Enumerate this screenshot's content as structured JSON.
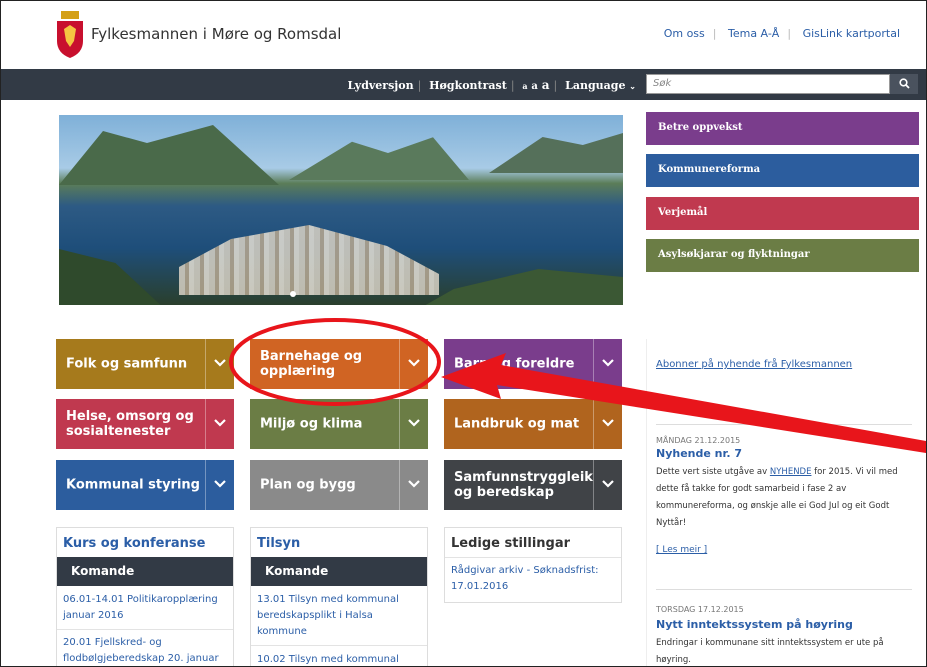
{
  "header": {
    "site_title": "Fylkesmannen i Møre og Romsdal",
    "top_links": [
      "Om oss",
      "Tema A-Å",
      "GisLink kartportal"
    ]
  },
  "toolbar": {
    "audio": "Lydversjon",
    "contrast": "Høgkontrast",
    "font_small": "a",
    "font_medium": "a",
    "font_large": "a",
    "language": "Language",
    "search_placeholder": "Søk",
    "search_icon": "search-icon"
  },
  "quick_links": [
    {
      "label": "Betre oppvekst",
      "color": "#7a3d8c"
    },
    {
      "label": "Kommunereforma",
      "color": "#2c5d9e"
    },
    {
      "label": "Verjemål",
      "color": "#c0394f"
    },
    {
      "label": "Asylsøkjarar og flyktningar",
      "color": "#6b7d45"
    }
  ],
  "tiles": [
    {
      "label": "Folk og samfunn",
      "color": "#a67a1c"
    },
    {
      "label": "Barnehage og opplæring",
      "color": "#d06423"
    },
    {
      "label": "Barn og foreldre",
      "color": "#7a3d8c"
    },
    {
      "label": "Helse, omsorg og sosialtenester",
      "color": "#c0394f"
    },
    {
      "label": "Miljø og klima",
      "color": "#6b7d45"
    },
    {
      "label": "Landbruk og mat",
      "color": "#b0641e"
    },
    {
      "label": "Kommunal styring",
      "color": "#2c5d9e"
    },
    {
      "label": "Plan og bygg",
      "color": "#8a8a8a"
    },
    {
      "label": "Samfunnstryggleik og beredskap",
      "color": "#404347"
    }
  ],
  "boxes": {
    "kurs": {
      "title": "Kurs og konferanse",
      "header": "Komande",
      "items": [
        "06.01-14.01 Politikaropplæring januar 2016",
        "20.01 Fjellskred- og flodbølgjeberedskap 20. januar"
      ]
    },
    "tilsyn": {
      "title": "Tilsyn",
      "header": "Komande",
      "items": [
        "13.01 Tilsyn med kommunal beredskapsplikt i Halsa kommune",
        "10.02 Tilsyn med kommunal"
      ]
    },
    "stillingar": {
      "title": "Ledige stillingar",
      "items": [
        "Rådgivar arkiv - Søknadsfrist: 17.01.2016"
      ]
    }
  },
  "news": {
    "subscribe": "Abonner på nyhende frå Fylkesmannen",
    "items": [
      {
        "date": "MÅNDAG 21.12.2015",
        "title": "Nyhende nr. 7",
        "text_before": "Dette vert siste utgåve av ",
        "text_link": "NYHENDE",
        "text_after": " for 2015. Vi vil med dette få takke for godt samarbeid i fase 2 av kommunereforma, og ønskje alle ei God Jul og eit Godt Nyttår!",
        "more": "[ Les meir ]"
      },
      {
        "date": "TORSDAG 17.12.2015",
        "title": "Nytt inntektssystem på høyring",
        "text": "Endringar i kommunane sitt inntektssystem er ute på høyring."
      }
    ]
  },
  "colors": {
    "navbar": "#323a45",
    "link": "#2b5ea7",
    "annotation": "#e8151b"
  }
}
